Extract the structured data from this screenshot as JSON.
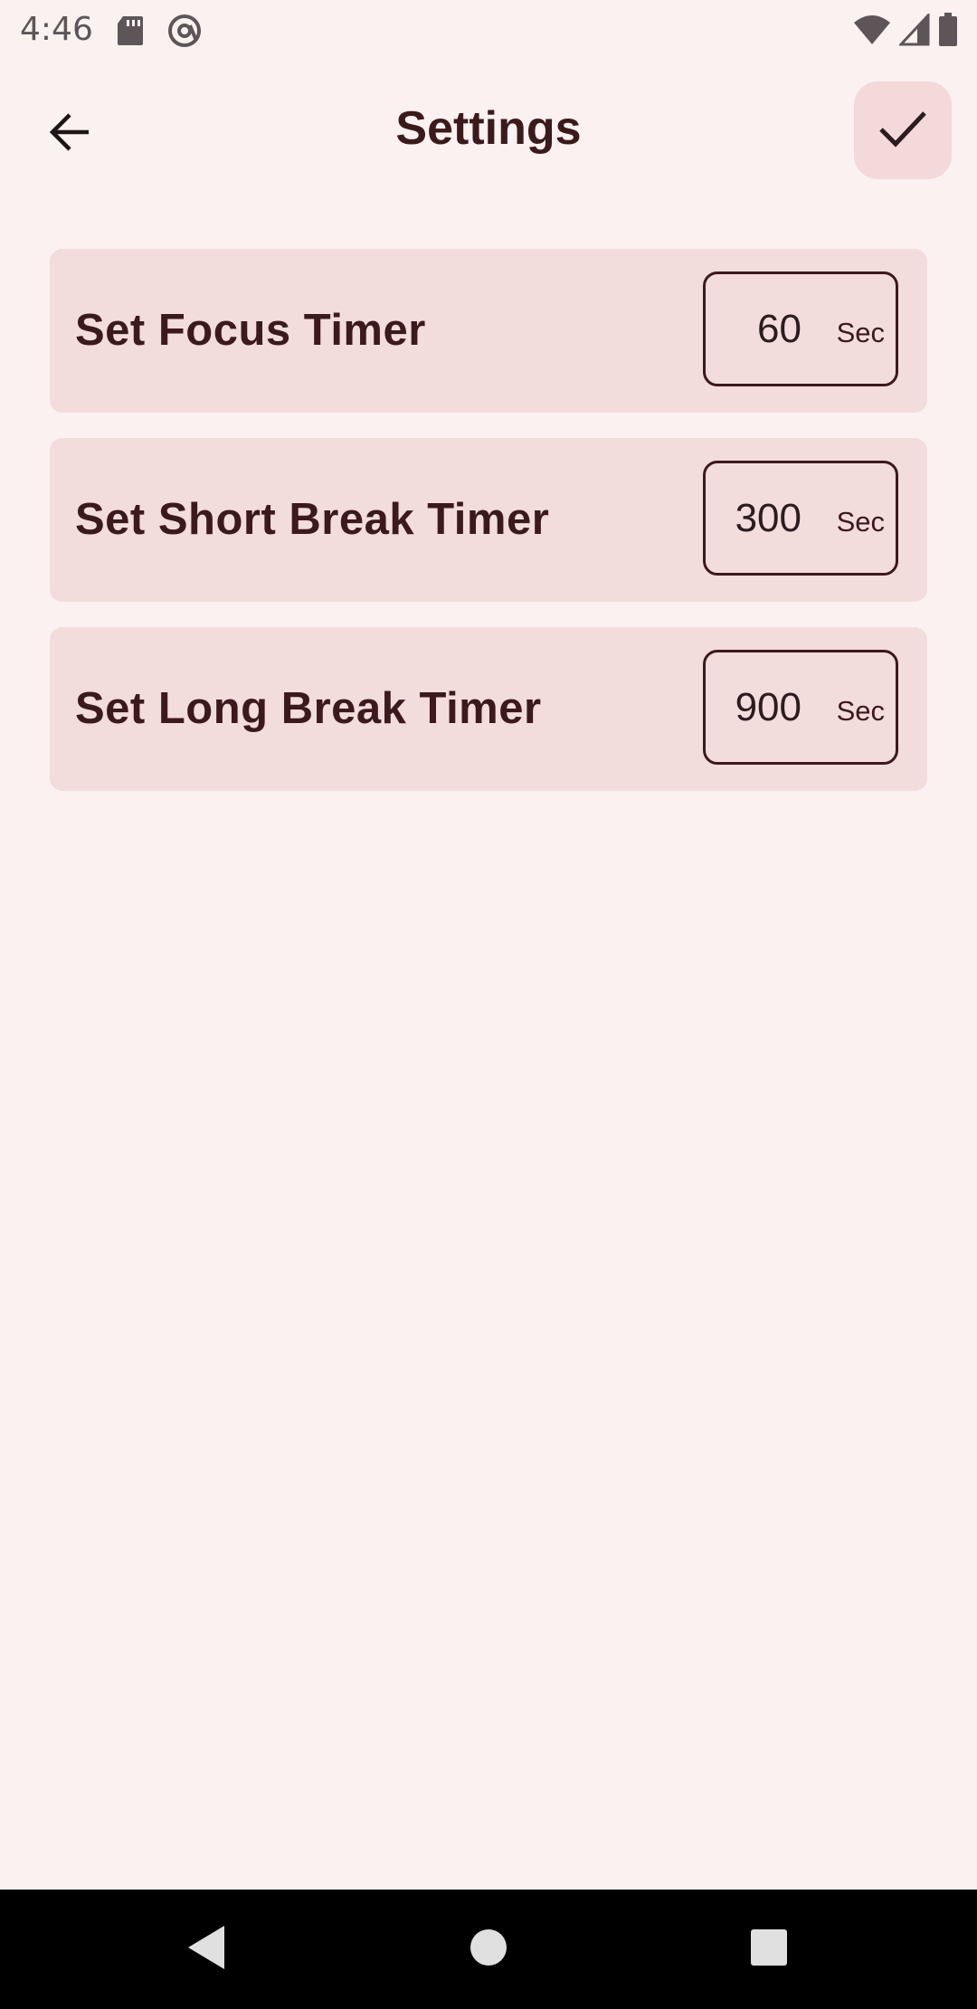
{
  "status_bar": {
    "time": "4:46",
    "left_icons": [
      "sd-card-icon",
      "at-sign-icon"
    ],
    "right_icons": [
      "wifi-icon",
      "cell-signal-icon",
      "battery-icon"
    ]
  },
  "app_bar": {
    "title": "Settings",
    "back_icon": "arrow-back-icon",
    "confirm_icon": "check-icon"
  },
  "settings": [
    {
      "label": "Set Focus Timer",
      "value": "60",
      "unit": "Sec"
    },
    {
      "label": "Set Short Break Timer",
      "value": "300",
      "unit": "Sec"
    },
    {
      "label": "Set Long Break Timer",
      "value": "900",
      "unit": "Sec"
    }
  ],
  "nav_bar": {
    "buttons": [
      "nav-back-icon",
      "nav-home-icon",
      "nav-recents-icon"
    ]
  },
  "colors": {
    "background": "#fcf1f1",
    "card": "#f3dcdc",
    "text": "#3b1a1c",
    "confirm_button": "#f3d9d9"
  }
}
